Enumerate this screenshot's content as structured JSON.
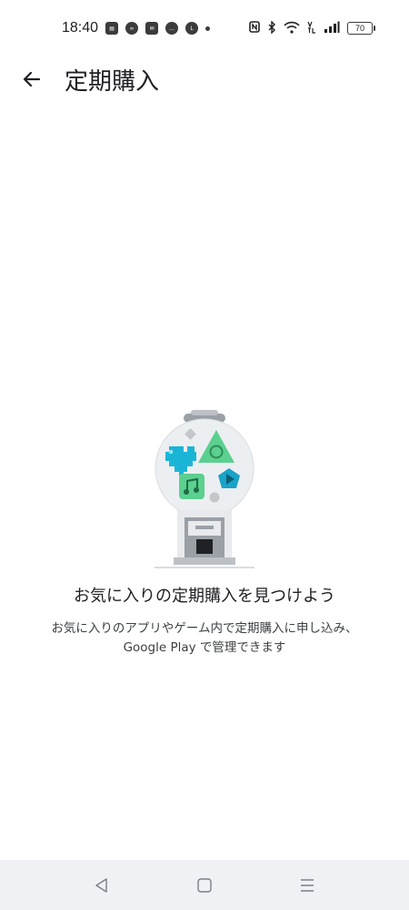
{
  "status_bar": {
    "time": "18:40",
    "battery": "70",
    "notification_icons": [
      "news-app-icon",
      "game-icon",
      "mail-icon",
      "chat-icon",
      "line-icon"
    ],
    "system_icons": [
      "nfc-icon",
      "bluetooth-icon",
      "wifi-icon",
      "volte-icon",
      "signal-icon",
      "battery-icon"
    ]
  },
  "app_bar": {
    "title": "定期購入"
  },
  "empty_state": {
    "title": "お気に入りの定期購入を見つけよう",
    "body": "お気に入りのアプリやゲーム内で定期購入に申し込み、Google Play で管理できます"
  },
  "colors": {
    "accent_teal": "#1aa3c8",
    "accent_green": "#5bd08f",
    "nav_bar_bg": "#eff1f5"
  }
}
